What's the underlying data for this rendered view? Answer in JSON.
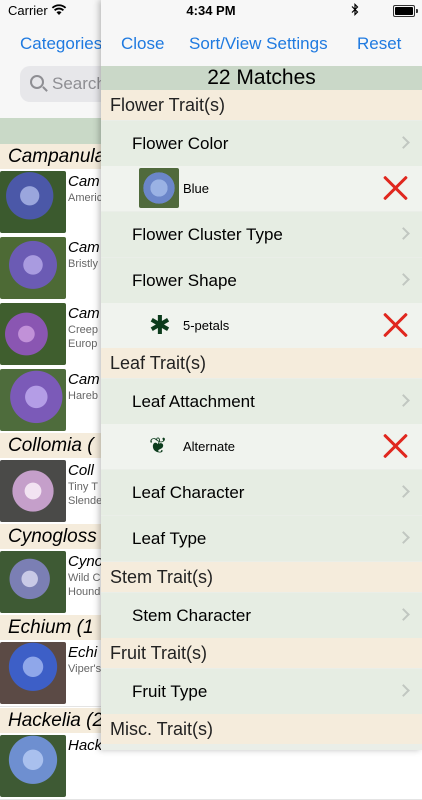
{
  "status_bar": {
    "carrier": "Carrier",
    "time": "4:34 PM"
  },
  "background_list": {
    "nav_button": "Categories",
    "search_placeholder": "Search",
    "groups": [
      {
        "header": "Campanula",
        "rows": [
          {
            "name": "Cam",
            "sub": "Americ",
            "color": "#4b58a8"
          },
          {
            "name": "Cam",
            "sub": "Bristly",
            "color": "#6b5bb4"
          },
          {
            "name": "Cam",
            "sub": "Creep\nEurop",
            "color": "#8a56b2"
          },
          {
            "name": "Cam",
            "sub": "Hareb",
            "color": "#7b5ab8"
          }
        ]
      },
      {
        "header": "Collomia (",
        "rows": [
          {
            "name": "Coll",
            "sub": "Tiny T\nSlende",
            "color": "#c59fca"
          }
        ]
      },
      {
        "header": "Cynogloss",
        "rows": [
          {
            "name": "Cyno",
            "sub": "Wild C\nHound",
            "color": "#7b7fb4"
          }
        ]
      },
      {
        "header": "Echium (1",
        "rows": [
          {
            "name": "Echi",
            "sub": "Viper's",
            "color": "#3d5fc7"
          }
        ]
      },
      {
        "header": "Hackelia (2",
        "rows": [
          {
            "name": "Hack",
            "sub": "",
            "color": "#6e8fd0"
          }
        ]
      }
    ]
  },
  "drawer": {
    "close_label": "Close",
    "sort_label": "Sort/View Settings",
    "reset_label": "Reset",
    "matches": "22 Matches",
    "sections": [
      {
        "title": "Flower Trait(s)",
        "items": [
          {
            "label": "Flower Color"
          },
          {
            "selected": "Blue",
            "icon": "blue-flower-photo"
          },
          {
            "label": "Flower Cluster Type"
          },
          {
            "label": "Flower Shape"
          },
          {
            "selected": "5-petals",
            "icon": "five-petal-icon",
            "glyph": "✱"
          }
        ]
      },
      {
        "title": "Leaf Trait(s)",
        "items": [
          {
            "label": "Leaf Attachment"
          },
          {
            "selected": "Alternate",
            "icon": "alternate-leaf-icon",
            "glyph": "❦"
          },
          {
            "label": "Leaf Character"
          },
          {
            "label": "Leaf Type"
          }
        ]
      },
      {
        "title": "Stem Trait(s)",
        "items": [
          {
            "label": "Stem Character"
          }
        ]
      },
      {
        "title": "Fruit Trait(s)",
        "items": [
          {
            "label": "Fruit Type"
          }
        ]
      },
      {
        "title": "Misc. Trait(s)",
        "items": []
      }
    ]
  },
  "colors": {
    "accent": "#1f7ae0",
    "remove": "#e0271e",
    "section_bg": "#f5ecdc",
    "item_bg": "#e6ede3",
    "matches_bg": "#cad8c8"
  }
}
